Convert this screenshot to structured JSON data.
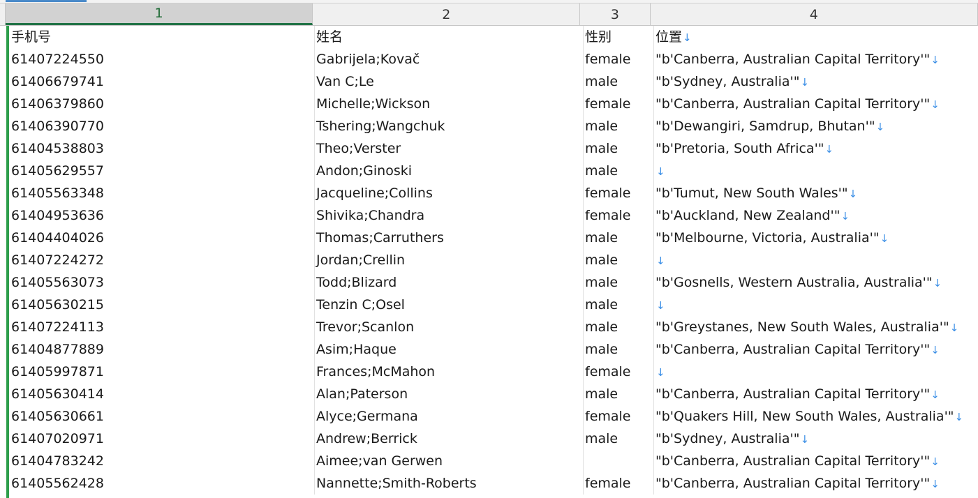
{
  "columns": [
    {
      "label": "1",
      "selected": true
    },
    {
      "label": "2",
      "selected": false
    },
    {
      "label": "3",
      "selected": false
    },
    {
      "label": "4",
      "selected": false
    }
  ],
  "line_break_marker": "↓",
  "rows": [
    {
      "phone": "手机号",
      "name": "姓名",
      "gender": "性别",
      "location": "位置",
      "eol": true
    },
    {
      "phone": "61407224550",
      "name": "Gabrijela;Kovač",
      "gender": "female",
      "location": "\"b'Canberra, Australian Capital Territory'\"",
      "eol": true
    },
    {
      "phone": "61406679741",
      "name": "Van C;Le",
      "gender": "male",
      "location": "\"b'Sydney, Australia'\"",
      "eol": true
    },
    {
      "phone": "61406379860",
      "name": "Michelle;Wickson",
      "gender": "female",
      "location": "\"b'Canberra, Australian Capital Territory'\"",
      "eol": true
    },
    {
      "phone": "61406390770",
      "name": "Tshering;Wangchuk",
      "gender": "male",
      "location": "\"b'Dewangiri, Samdrup, Bhutan'\"",
      "eol": true
    },
    {
      "phone": "61404538803",
      "name": "Theo;Verster",
      "gender": "male",
      "location": "\"b'Pretoria, South Africa'\"",
      "eol": true
    },
    {
      "phone": "61405629557",
      "name": "Andon;Ginoski",
      "gender": "male",
      "location": "",
      "eol": true
    },
    {
      "phone": "61405563348",
      "name": "Jacqueline;Collins",
      "gender": "female",
      "location": "\"b'Tumut, New South Wales'\"",
      "eol": true
    },
    {
      "phone": "61404953636",
      "name": "Shivika;Chandra",
      "gender": "female",
      "location": "\"b'Auckland, New Zealand'\"",
      "eol": true
    },
    {
      "phone": "61404404026",
      "name": "Thomas;Carruthers",
      "gender": "male",
      "location": "\"b'Melbourne, Victoria, Australia'\"",
      "eol": true
    },
    {
      "phone": "61407224272",
      "name": "Jordan;Crellin",
      "gender": "male",
      "location": "",
      "eol": true
    },
    {
      "phone": "61405563073",
      "name": "Todd;Blizard",
      "gender": "male",
      "location": "\"b'Gosnells, Western Australia, Australia'\"",
      "eol": true
    },
    {
      "phone": "61405630215",
      "name": "Tenzin C;Osel",
      "gender": "male",
      "location": "",
      "eol": true
    },
    {
      "phone": "61407224113",
      "name": "Trevor;Scanlon",
      "gender": "male",
      "location": "\"b'Greystanes, New South Wales, Australia'\"",
      "eol": true
    },
    {
      "phone": "61404877889",
      "name": "Asim;Haque",
      "gender": "male",
      "location": "\"b'Canberra, Australian Capital Territory'\"",
      "eol": true
    },
    {
      "phone": "61405997871",
      "name": "Frances;McMahon",
      "gender": "female",
      "location": "",
      "eol": true
    },
    {
      "phone": "61405630414",
      "name": "Alan;Paterson",
      "gender": "male",
      "location": "\"b'Canberra, Australian Capital Territory'\"",
      "eol": true
    },
    {
      "phone": "61405630661",
      "name": "Alyce;Germana",
      "gender": "female",
      "location": "\"b'Quakers Hill, New South Wales, Australia'\"",
      "eol": true
    },
    {
      "phone": "61407020971",
      "name": "Andrew;Berrick",
      "gender": "male",
      "location": "\"b'Sydney, Australia'\"",
      "eol": true
    },
    {
      "phone": "61404783242",
      "name": "Aimee;van Gerwen",
      "gender": "",
      "location": "\"b'Canberra, Australian Capital Territory'\"",
      "eol": true
    },
    {
      "phone": "61405562428",
      "name": "Nannette;Smith-Roberts",
      "gender": "female",
      "location": "\"b'Canberra, Australian Capital Territory'\"",
      "eol": true
    }
  ]
}
